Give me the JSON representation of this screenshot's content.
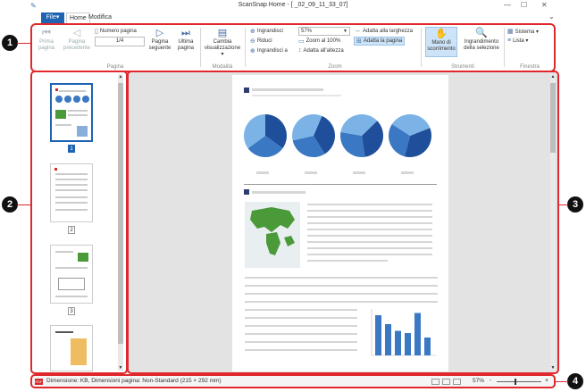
{
  "window": {
    "title": "ScanSnap Home - [          _02_09_11_33_07]",
    "minimize": "—",
    "maximize": "☐",
    "close": "✕",
    "collapse_ribbon": "⌄"
  },
  "tabs": {
    "file": "File▾",
    "home": "Home",
    "modifica": "Modifica"
  },
  "ribbon": {
    "pagina": {
      "label": "Pagina",
      "first_page": "Prima pagina",
      "prev_page": "Pagina precedente",
      "page_number_label": "Numero pagina",
      "page_number_value": "1/4",
      "next_page": "Pagina seguente",
      "last_page": "Ultima pagina"
    },
    "modalita": {
      "label": "Modalità",
      "change_view": "Cambia visualizzazione ▾"
    },
    "zoom": {
      "label": "Zoom",
      "zoom_in": "Ingrandisci",
      "zoom_out": "Riduci",
      "zoom_to": "Ingrandisci a",
      "zoom_value": "57%",
      "zoom_100": "Zoom al 100%",
      "fit_height": "Adatta all'altezza",
      "fit_width": "Adatta alla larghezza",
      "fit_page": "Adatta la pagina"
    },
    "strumenti": {
      "label": "Strumenti",
      "hand": "Mano di scorrimento",
      "magnifier": "Ingrandimento della selezione"
    },
    "finestra": {
      "label": "Finestra",
      "sistema": "Sistema ▾",
      "lista": "Lista ▾"
    }
  },
  "callouts": [
    "1",
    "2",
    "3",
    "4"
  ],
  "thumbnails": {
    "close": "✕",
    "items": [
      {
        "num": "1",
        "selected": true
      },
      {
        "num": "2",
        "selected": false
      },
      {
        "num": "3",
        "selected": false
      }
    ]
  },
  "status": {
    "badge": "PDF",
    "text": "Dimensione:       KB, Dimensioni pagina: Non-Standard (215 × 292 mm)",
    "zoom": "57%",
    "zoom_minus": "-",
    "zoom_plus": "+"
  },
  "colors": {
    "accent_red": "#e0282c",
    "file_tab_blue": "#1f63b3",
    "chart_blue": "#3a78c4"
  },
  "document_chart": {
    "values": [
      90,
      70,
      55,
      50,
      95,
      40
    ]
  }
}
